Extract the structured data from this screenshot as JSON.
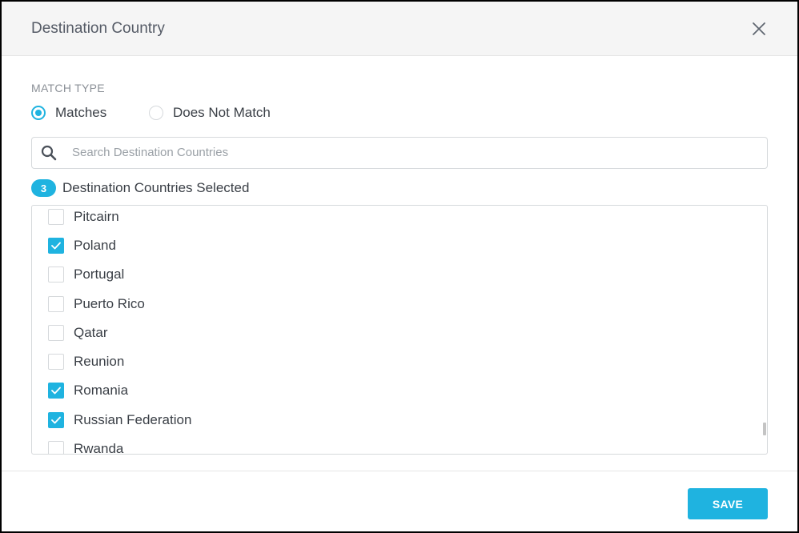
{
  "dialog": {
    "title": "Destination Country",
    "close_icon": "close-icon"
  },
  "match_type": {
    "label": "MATCH TYPE",
    "options": [
      {
        "label": "Matches",
        "selected": true
      },
      {
        "label": "Does Not Match",
        "selected": false
      }
    ]
  },
  "search": {
    "placeholder": "Search Destination Countries",
    "value": "",
    "icon": "search-icon"
  },
  "selection": {
    "count": "3",
    "label": "Destination Countries Selected"
  },
  "countries": [
    {
      "label": "Pitcairn",
      "checked": false
    },
    {
      "label": "Poland",
      "checked": true
    },
    {
      "label": "Portugal",
      "checked": false
    },
    {
      "label": "Puerto Rico",
      "checked": false
    },
    {
      "label": "Qatar",
      "checked": false
    },
    {
      "label": "Reunion",
      "checked": false
    },
    {
      "label": "Romania",
      "checked": true
    },
    {
      "label": "Russian Federation",
      "checked": true
    },
    {
      "label": "Rwanda",
      "checked": false
    }
  ],
  "footer": {
    "save_label": "SAVE"
  },
  "colors": {
    "accent": "#1fb3e0",
    "text": "#3a3f46",
    "muted": "#8b9097",
    "header_bg": "#f5f5f5"
  }
}
